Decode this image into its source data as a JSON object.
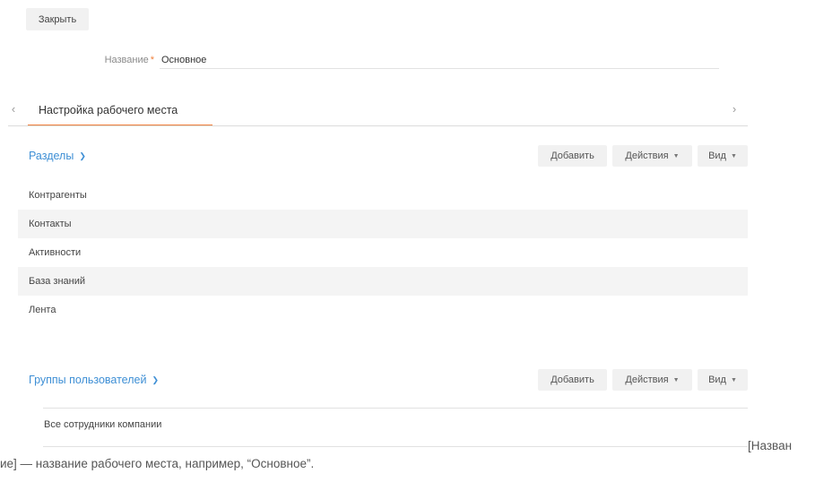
{
  "toolbar": {
    "close_label": "Закрыть"
  },
  "form": {
    "name_label": "Название",
    "required_mark": "*",
    "name_value": "Основное"
  },
  "tabs": {
    "prev_icon": "chevron-left-icon",
    "next_icon": "chevron-right-icon",
    "items": [
      {
        "label": "Настройка рабочего места",
        "active": true
      }
    ],
    "accent_color": "#f0803c"
  },
  "sections_block": {
    "title": "Разделы",
    "buttons": {
      "add": "Добавить",
      "actions": "Действия",
      "view": "Вид"
    },
    "items": [
      {
        "label": "Контрагенты"
      },
      {
        "label": "Контакты"
      },
      {
        "label": "Активности"
      },
      {
        "label": "База знаний"
      },
      {
        "label": "Лента"
      }
    ]
  },
  "groups_block": {
    "title": "Группы пользователей",
    "buttons": {
      "add": "Добавить",
      "actions": "Действия",
      "view": "Вид"
    },
    "items": [
      {
        "label": "Все сотрудники компании"
      }
    ]
  },
  "caption": {
    "line1": "[Назван",
    "line2": "ие] — название рабочего места, например, “Основное”."
  },
  "colors": {
    "link": "#3e8fd5",
    "accent": "#f0803c",
    "button_bg": "#f1f1f1"
  }
}
